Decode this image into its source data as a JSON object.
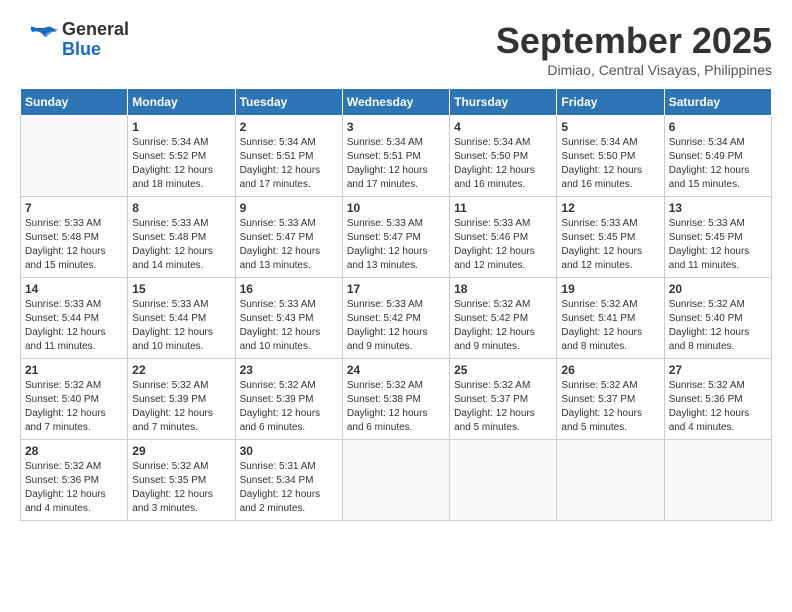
{
  "header": {
    "logo_general": "General",
    "logo_blue": "Blue",
    "month_title": "September 2025",
    "location": "Dimiao, Central Visayas, Philippines"
  },
  "days_of_week": [
    "Sunday",
    "Monday",
    "Tuesday",
    "Wednesday",
    "Thursday",
    "Friday",
    "Saturday"
  ],
  "weeks": [
    [
      {
        "day": "",
        "sunrise": "",
        "sunset": "",
        "daylight": ""
      },
      {
        "day": "1",
        "sunrise": "Sunrise: 5:34 AM",
        "sunset": "Sunset: 5:52 PM",
        "daylight": "Daylight: 12 hours and 18 minutes."
      },
      {
        "day": "2",
        "sunrise": "Sunrise: 5:34 AM",
        "sunset": "Sunset: 5:51 PM",
        "daylight": "Daylight: 12 hours and 17 minutes."
      },
      {
        "day": "3",
        "sunrise": "Sunrise: 5:34 AM",
        "sunset": "Sunset: 5:51 PM",
        "daylight": "Daylight: 12 hours and 17 minutes."
      },
      {
        "day": "4",
        "sunrise": "Sunrise: 5:34 AM",
        "sunset": "Sunset: 5:50 PM",
        "daylight": "Daylight: 12 hours and 16 minutes."
      },
      {
        "day": "5",
        "sunrise": "Sunrise: 5:34 AM",
        "sunset": "Sunset: 5:50 PM",
        "daylight": "Daylight: 12 hours and 16 minutes."
      },
      {
        "day": "6",
        "sunrise": "Sunrise: 5:34 AM",
        "sunset": "Sunset: 5:49 PM",
        "daylight": "Daylight: 12 hours and 15 minutes."
      }
    ],
    [
      {
        "day": "7",
        "sunrise": "Sunrise: 5:33 AM",
        "sunset": "Sunset: 5:48 PM",
        "daylight": "Daylight: 12 hours and 15 minutes."
      },
      {
        "day": "8",
        "sunrise": "Sunrise: 5:33 AM",
        "sunset": "Sunset: 5:48 PM",
        "daylight": "Daylight: 12 hours and 14 minutes."
      },
      {
        "day": "9",
        "sunrise": "Sunrise: 5:33 AM",
        "sunset": "Sunset: 5:47 PM",
        "daylight": "Daylight: 12 hours and 13 minutes."
      },
      {
        "day": "10",
        "sunrise": "Sunrise: 5:33 AM",
        "sunset": "Sunset: 5:47 PM",
        "daylight": "Daylight: 12 hours and 13 minutes."
      },
      {
        "day": "11",
        "sunrise": "Sunrise: 5:33 AM",
        "sunset": "Sunset: 5:46 PM",
        "daylight": "Daylight: 12 hours and 12 minutes."
      },
      {
        "day": "12",
        "sunrise": "Sunrise: 5:33 AM",
        "sunset": "Sunset: 5:45 PM",
        "daylight": "Daylight: 12 hours and 12 minutes."
      },
      {
        "day": "13",
        "sunrise": "Sunrise: 5:33 AM",
        "sunset": "Sunset: 5:45 PM",
        "daylight": "Daylight: 12 hours and 11 minutes."
      }
    ],
    [
      {
        "day": "14",
        "sunrise": "Sunrise: 5:33 AM",
        "sunset": "Sunset: 5:44 PM",
        "daylight": "Daylight: 12 hours and 11 minutes."
      },
      {
        "day": "15",
        "sunrise": "Sunrise: 5:33 AM",
        "sunset": "Sunset: 5:44 PM",
        "daylight": "Daylight: 12 hours and 10 minutes."
      },
      {
        "day": "16",
        "sunrise": "Sunrise: 5:33 AM",
        "sunset": "Sunset: 5:43 PM",
        "daylight": "Daylight: 12 hours and 10 minutes."
      },
      {
        "day": "17",
        "sunrise": "Sunrise: 5:33 AM",
        "sunset": "Sunset: 5:42 PM",
        "daylight": "Daylight: 12 hours and 9 minutes."
      },
      {
        "day": "18",
        "sunrise": "Sunrise: 5:32 AM",
        "sunset": "Sunset: 5:42 PM",
        "daylight": "Daylight: 12 hours and 9 minutes."
      },
      {
        "day": "19",
        "sunrise": "Sunrise: 5:32 AM",
        "sunset": "Sunset: 5:41 PM",
        "daylight": "Daylight: 12 hours and 8 minutes."
      },
      {
        "day": "20",
        "sunrise": "Sunrise: 5:32 AM",
        "sunset": "Sunset: 5:40 PM",
        "daylight": "Daylight: 12 hours and 8 minutes."
      }
    ],
    [
      {
        "day": "21",
        "sunrise": "Sunrise: 5:32 AM",
        "sunset": "Sunset: 5:40 PM",
        "daylight": "Daylight: 12 hours and 7 minutes."
      },
      {
        "day": "22",
        "sunrise": "Sunrise: 5:32 AM",
        "sunset": "Sunset: 5:39 PM",
        "daylight": "Daylight: 12 hours and 7 minutes."
      },
      {
        "day": "23",
        "sunrise": "Sunrise: 5:32 AM",
        "sunset": "Sunset: 5:39 PM",
        "daylight": "Daylight: 12 hours and 6 minutes."
      },
      {
        "day": "24",
        "sunrise": "Sunrise: 5:32 AM",
        "sunset": "Sunset: 5:38 PM",
        "daylight": "Daylight: 12 hours and 6 minutes."
      },
      {
        "day": "25",
        "sunrise": "Sunrise: 5:32 AM",
        "sunset": "Sunset: 5:37 PM",
        "daylight": "Daylight: 12 hours and 5 minutes."
      },
      {
        "day": "26",
        "sunrise": "Sunrise: 5:32 AM",
        "sunset": "Sunset: 5:37 PM",
        "daylight": "Daylight: 12 hours and 5 minutes."
      },
      {
        "day": "27",
        "sunrise": "Sunrise: 5:32 AM",
        "sunset": "Sunset: 5:36 PM",
        "daylight": "Daylight: 12 hours and 4 minutes."
      }
    ],
    [
      {
        "day": "28",
        "sunrise": "Sunrise: 5:32 AM",
        "sunset": "Sunset: 5:36 PM",
        "daylight": "Daylight: 12 hours and 4 minutes."
      },
      {
        "day": "29",
        "sunrise": "Sunrise: 5:32 AM",
        "sunset": "Sunset: 5:35 PM",
        "daylight": "Daylight: 12 hours and 3 minutes."
      },
      {
        "day": "30",
        "sunrise": "Sunrise: 5:31 AM",
        "sunset": "Sunset: 5:34 PM",
        "daylight": "Daylight: 12 hours and 2 minutes."
      },
      {
        "day": "",
        "sunrise": "",
        "sunset": "",
        "daylight": ""
      },
      {
        "day": "",
        "sunrise": "",
        "sunset": "",
        "daylight": ""
      },
      {
        "day": "",
        "sunrise": "",
        "sunset": "",
        "daylight": ""
      },
      {
        "day": "",
        "sunrise": "",
        "sunset": "",
        "daylight": ""
      }
    ]
  ]
}
